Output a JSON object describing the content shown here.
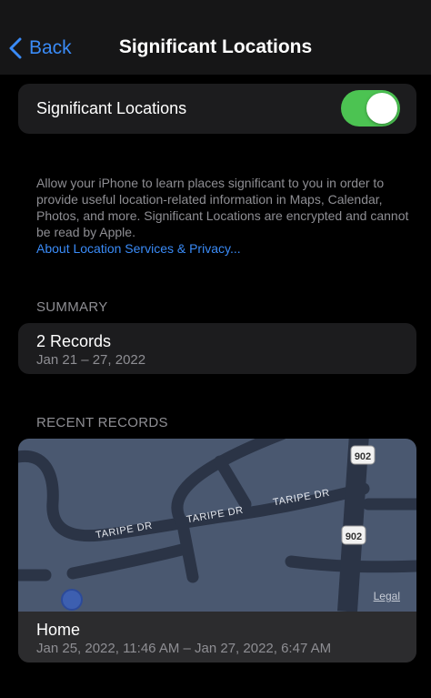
{
  "nav": {
    "back_label": "Back",
    "title": "Significant Locations"
  },
  "toggle": {
    "label": "Significant Locations",
    "enabled": true,
    "on_color": "#4cc352"
  },
  "description": {
    "text": "Allow your iPhone to learn places significant to you in order to provide useful location-related information in Maps, Calendar, Photos, and more. Significant Locations are encrypted and cannot be read by Apple.",
    "link": "About Location Services & Privacy..."
  },
  "summary": {
    "header": "SUMMARY",
    "title": "2 Records",
    "date_range": "Jan 21 – 27, 2022"
  },
  "recent": {
    "header": "RECENT RECORDS",
    "map": {
      "street_labels": [
        "TARIPE DR",
        "TARIPE DR",
        "TARIPE DR"
      ],
      "route_shields": [
        "902",
        "902"
      ],
      "legal": "Legal"
    },
    "record": {
      "title": "Home",
      "time_range": "Jan 25, 2022, 11:46 AM – Jan 27, 2022, 6:47 AM"
    }
  },
  "colors": {
    "accent": "#3a8bf7",
    "background": "#000000",
    "card": "#1c1c1e",
    "secondary_text": "#8e8e93"
  }
}
